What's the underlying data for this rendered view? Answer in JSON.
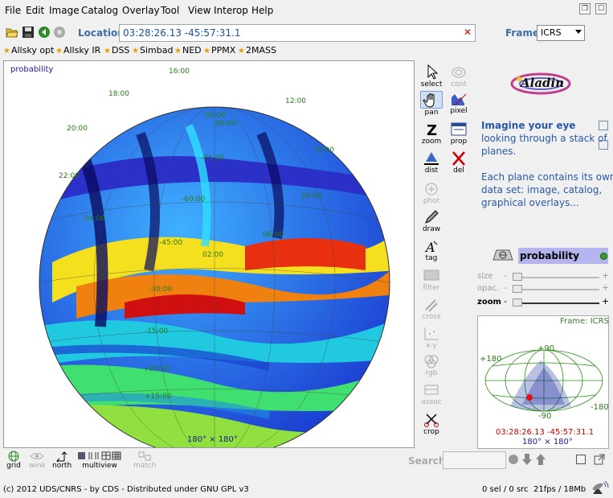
{
  "menu": [
    "File",
    "Edit",
    "Image",
    "Catalog",
    "Overlay",
    "Tool",
    "View",
    "Interop",
    "Help"
  ],
  "location": {
    "label": "Location",
    "value": "03:28:26.13 -45:57:31.1",
    "clear": "✕"
  },
  "frame": {
    "label": "Frame",
    "value": "ICRS"
  },
  "bookmarks": [
    "Allsky opt",
    "Allsky IR",
    "DSS",
    "Simbad",
    "NED",
    "PPMX",
    "2MASS"
  ],
  "view": {
    "label": "probability",
    "size": "180° × 180°",
    "grid_labels": [
      "16:00",
      "18:00",
      "20:00",
      "22:00",
      "12:00",
      "10:00",
      "08:00",
      "06:00",
      "04:00",
      "02:00",
      "00:00",
      "-90:00",
      "-75:00",
      "-60:00",
      "-45:00",
      "-30:00",
      "-15:00",
      "+00:00",
      "+15:00"
    ]
  },
  "tools": {
    "select": "select",
    "cont": "cont",
    "pan": "pan",
    "pixel": "pixel",
    "zoom": "zoom",
    "prop": "prop",
    "dist": "dist",
    "del": "del",
    "phot": "phot",
    "draw": "draw",
    "tag": "tag",
    "filter": "filter",
    "cross": "cross",
    "xy": "x-y",
    "rgb": "rgb",
    "assoc": "assoc",
    "crop": "crop"
  },
  "help": {
    "title": "Imagine your eye",
    "lines": [
      "looking through a stack of",
      "planes.",
      "",
      "Each plane contains its own",
      "data set: image, catalog,",
      "graphical overlays..."
    ]
  },
  "plane": {
    "name": "probability"
  },
  "sliders": {
    "size": "size",
    "opac": "opac.",
    "zoom": "zoom"
  },
  "preview": {
    "frame": "Frame: ICRS",
    "labels": {
      "top": "+90",
      "left": "+180",
      "right": "-180",
      "bottom": "-90"
    },
    "coord": "03:28:26.13 -45:57:31.1",
    "size": "180° × 180°"
  },
  "bottom": {
    "grid": "grid",
    "wink": "wink",
    "north": "north",
    "multiview": "multiview",
    "match": "match",
    "search": "Search"
  },
  "status": {
    "copyright": "(c) 2012 UDS/CNRS - by CDS - Distributed under GNU GPL v3",
    "sel": "0 sel / 0 src",
    "fps": "21fps / 18Mb"
  },
  "colors": {
    "accent": "#2a58a8",
    "plane_bg": "#b4b4ee",
    "grid": "#2a7a1a"
  }
}
